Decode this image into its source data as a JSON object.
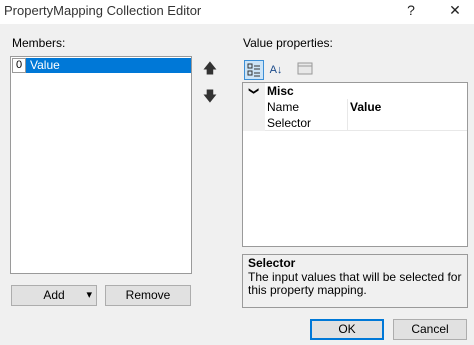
{
  "window": {
    "title": "PropertyMapping Collection Editor",
    "help_glyph": "?",
    "close_glyph": "✕"
  },
  "members": {
    "label": "Members:",
    "items": [
      {
        "index": "0",
        "value": "Value"
      }
    ]
  },
  "move_up_glyph": "🡅",
  "move_down_glyph": "🡇",
  "buttons": {
    "add": "Add",
    "add_dropdown_glyph": "▾",
    "remove": "Remove",
    "ok": "OK",
    "cancel": "Cancel"
  },
  "properties": {
    "label": "Value properties:",
    "toolbar": {
      "categorized_icon": "categorized-icon",
      "alphabetical_icon": "alphabetical-icon",
      "property_pages_icon": "property-pages-icon",
      "alphabetical_glyph": "A↓"
    },
    "category": {
      "toggle_glyph": "❯",
      "name": "Misc"
    },
    "rows": [
      {
        "name": "Name",
        "value": "Value"
      },
      {
        "name": "Selector",
        "value": ""
      }
    ],
    "help": {
      "title": "Selector",
      "description": "The input values that will be selected for this property mapping."
    }
  },
  "colors": {
    "selection": "#0078d7",
    "window_bg": "#f0f0f0",
    "accent_border": "#0078d7"
  }
}
